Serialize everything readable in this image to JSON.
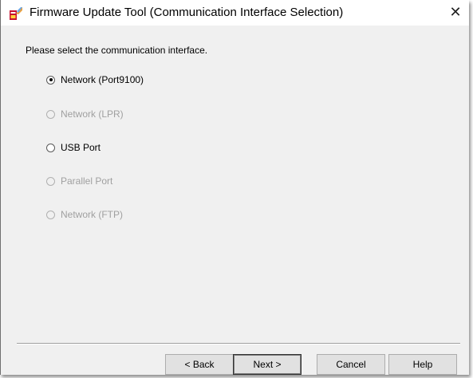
{
  "window": {
    "title": "Firmware Update Tool (Communication Interface Selection)",
    "close_label": "✕",
    "app_icon": "firmware-update-app-icon"
  },
  "main": {
    "prompt": "Please select the communication interface.",
    "options": [
      {
        "label": "Network (Port9100)",
        "selected": true,
        "enabled": true
      },
      {
        "label": "Network (LPR)",
        "selected": false,
        "enabled": false
      },
      {
        "label": "USB Port",
        "selected": false,
        "enabled": true
      },
      {
        "label": "Parallel Port",
        "selected": false,
        "enabled": false
      },
      {
        "label": "Network (FTP)",
        "selected": false,
        "enabled": false
      }
    ]
  },
  "buttons": {
    "back": "< Back",
    "next": "Next >",
    "cancel": "Cancel",
    "help": "Help"
  },
  "colors": {
    "dialog_background": "#f0f0f0",
    "disabled_text": "#a0a0a0"
  }
}
